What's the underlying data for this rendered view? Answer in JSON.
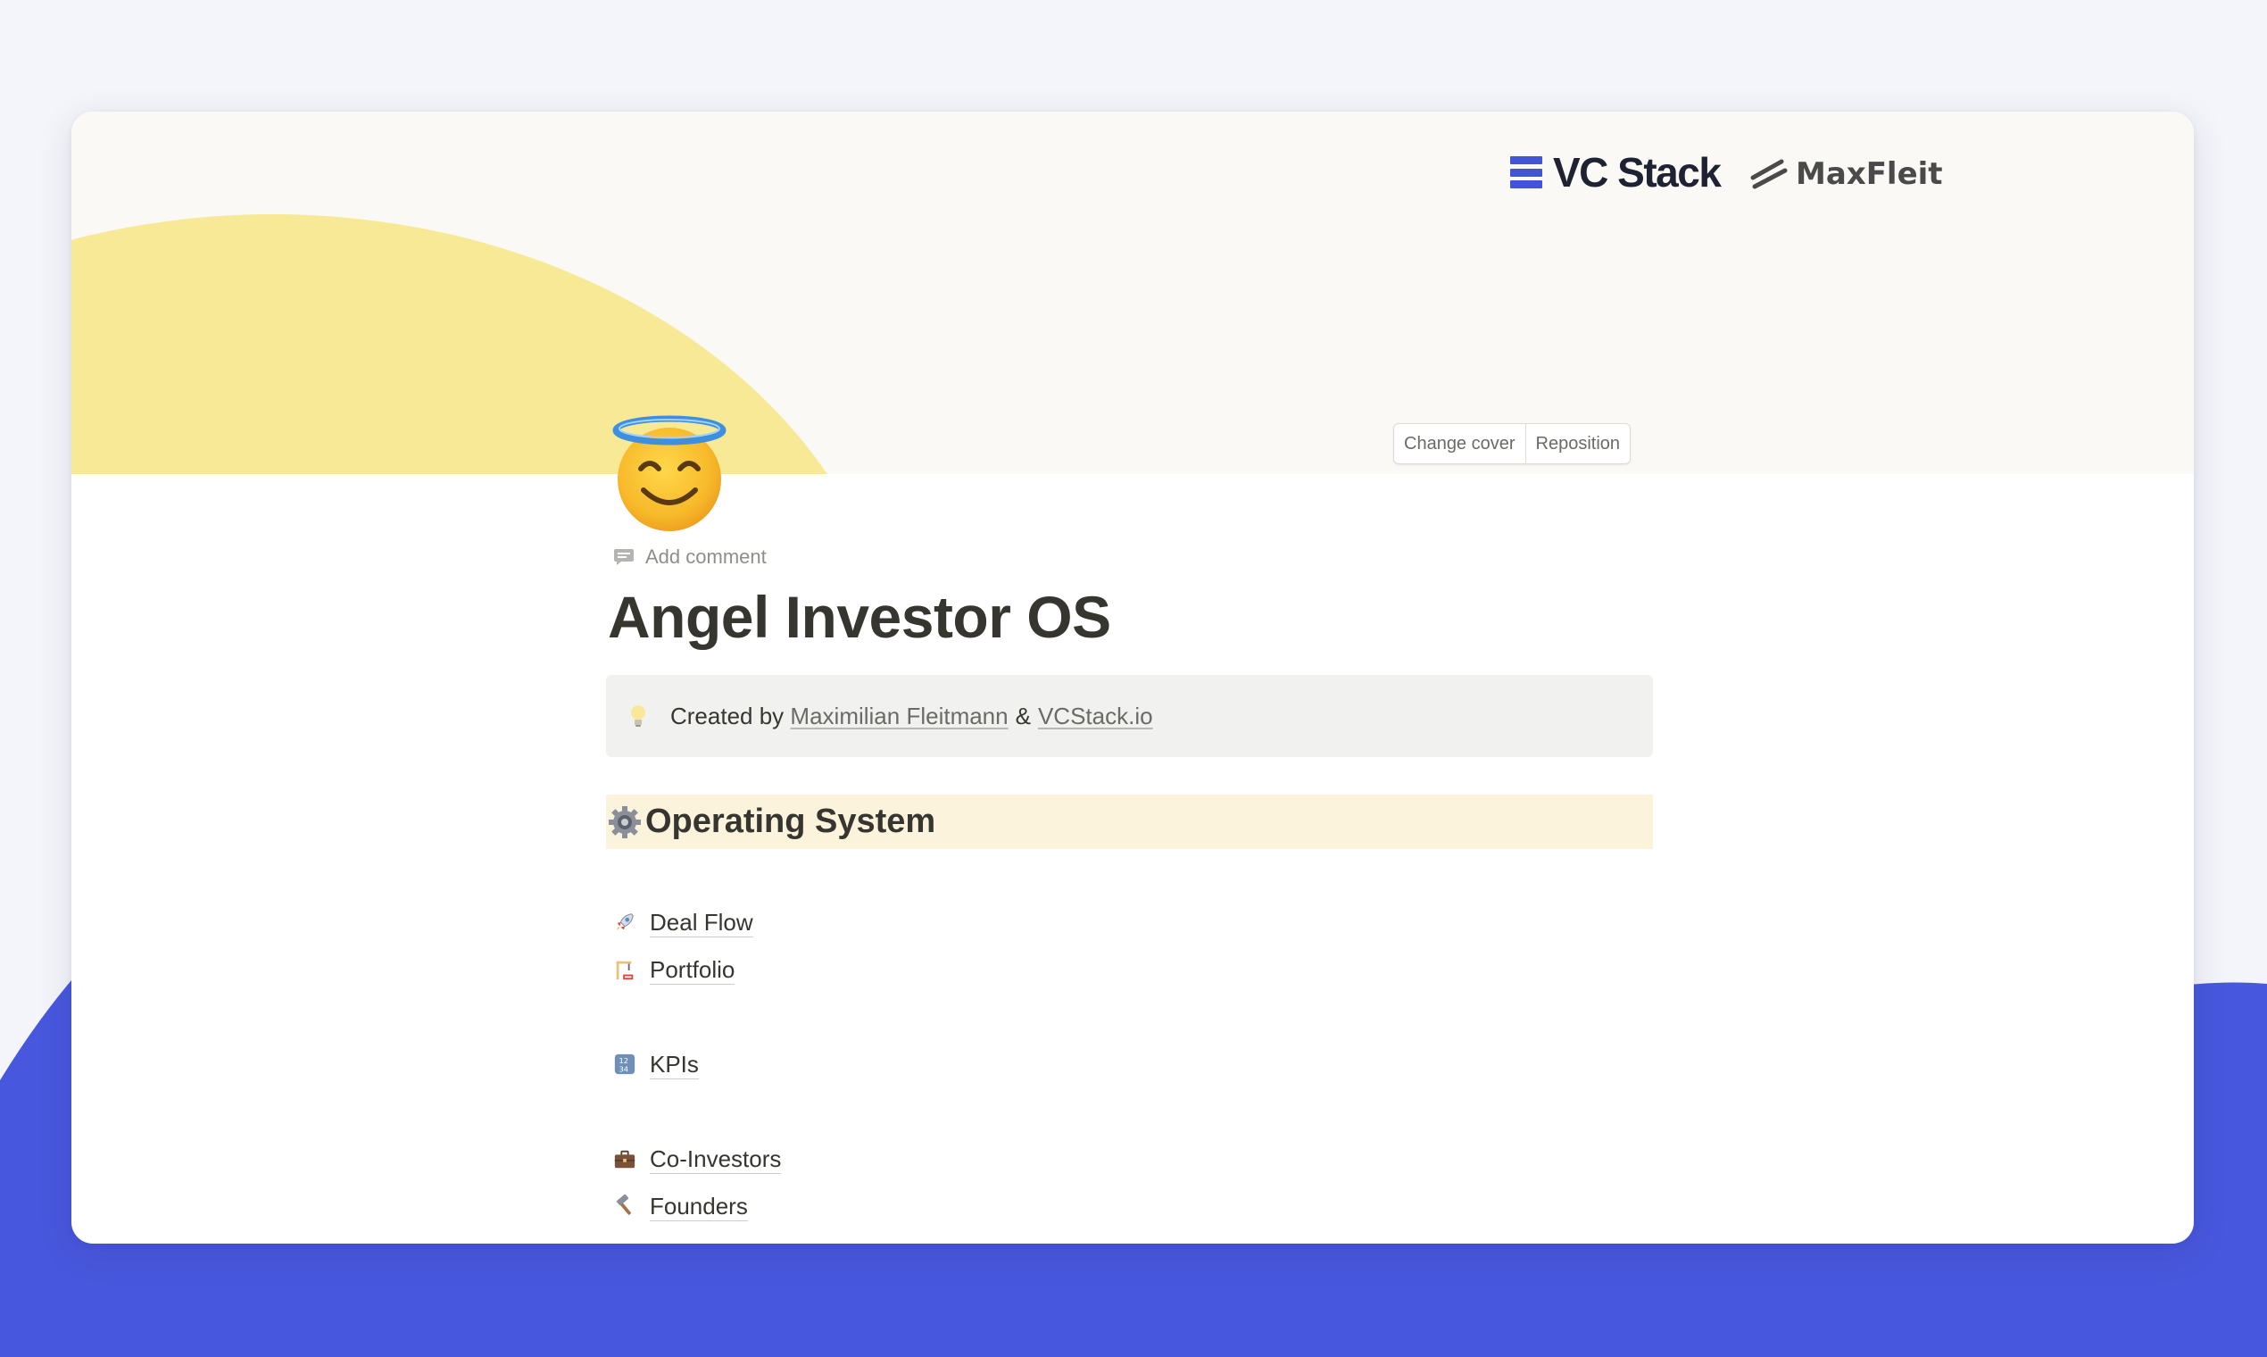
{
  "cover": {
    "change_cover_label": "Change cover",
    "reposition_label": "Reposition",
    "logos": [
      "VC Stack",
      "MaxFleit"
    ],
    "colors": {
      "sun": "#f7e995",
      "cover_bg": "#faf9f5",
      "accent_blue": "#4858de"
    }
  },
  "page": {
    "icon": "smiling-face-with-halo-icon",
    "add_comment_label": "Add comment",
    "title": "Angel Investor OS"
  },
  "callout": {
    "icon": "light-bulb-icon",
    "prefix": "Created by",
    "author": "Maximilian Fleitmann",
    "separator": "&",
    "site": "VCStack.io"
  },
  "section": {
    "icon": "gear-icon",
    "title": "Operating System"
  },
  "links": [
    {
      "icon": "rocket-icon",
      "label": "Deal Flow"
    },
    {
      "icon": "construction-icon",
      "label": "Portfolio"
    },
    {
      "icon": "numbers-icon",
      "label": "KPIs"
    },
    {
      "icon": "briefcase-icon",
      "label": "Co-Investors"
    },
    {
      "icon": "hammer-icon",
      "label": "Founders"
    }
  ]
}
